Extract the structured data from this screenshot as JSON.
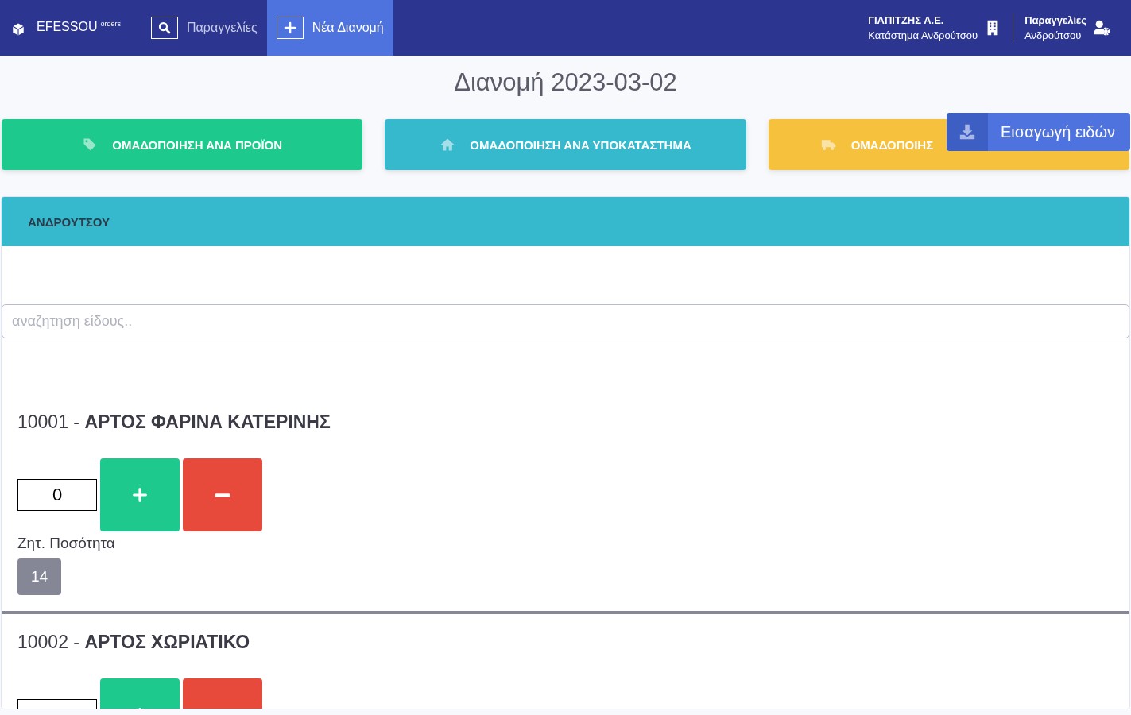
{
  "navbar": {
    "brand": "EFESSOU",
    "brand_sup": "orders",
    "links": [
      {
        "label": "Παραγγελίες",
        "selected": false
      },
      {
        "label": "Νέα Διανομή",
        "selected": true
      }
    ],
    "company": {
      "name": "ΓΙΑΠΙΤΖΗΣ Α.Ε.",
      "store": "Κατάστημα Ανδρούτσου"
    },
    "user": {
      "role": "Παραγγελίες",
      "name": "Ανδρούτσου"
    }
  },
  "page_title": "Διανομή 2023-03-02",
  "group_buttons": [
    {
      "label": "ΟΜΑΔΟΠΟΙΗΣΗ ΑΝΑ ΠΡΟΪΟΝ",
      "color": "#1dc98c"
    },
    {
      "label": "ΟΜΑΔΟΠΟΙΗΣΗ ΑΝΑ ΥΠΟΚΑΤΑΣΤΗΜΑ",
      "color": "#36b9cc"
    },
    {
      "label": "ΟΜΑΔΟΠΟΙΗΣ",
      "color": "#f6c23e"
    }
  ],
  "import_button": {
    "label": "Εισαγωγή ειδών"
  },
  "card": {
    "header": "ΑΝΔΡΟΥΤΣΟΥ",
    "search": {
      "placeholder": "αναζητηση είδους.."
    },
    "items": [
      {
        "title": "10001 - **ΑΡΤΟΣ ΦΑΡΙΝΑ ΚΑΤΕΡΙΝΗΣ**",
        "quantity": "0",
        "requested_label": "Ζητ. Ποσότητα",
        "requested": "14"
      },
      {
        "title": "10002 - **ΑΡΤΟΣ ΧΩΡΙΑΤΙΚΟ**"
      }
    ]
  }
}
